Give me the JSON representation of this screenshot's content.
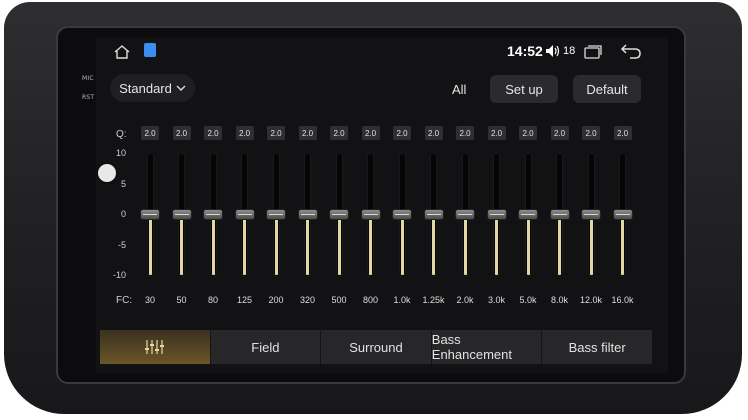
{
  "hardware": {
    "mic_label": "MIC",
    "rst_label": "RST"
  },
  "status_bar": {
    "time": "14:52",
    "volume": "18",
    "icons": [
      "home-icon",
      "app-icon",
      "volume-icon",
      "window-icon",
      "back-icon"
    ]
  },
  "toolbar": {
    "preset_label": "Standard",
    "all_label": "All",
    "setup_label": "Set up",
    "default_label": "Default"
  },
  "eq": {
    "q_label": "Q:",
    "fc_label": "FC:",
    "y_ticks": [
      "10",
      "5",
      "0",
      "-5",
      "-10"
    ],
    "bands": [
      {
        "fc": "30",
        "q": "2.0",
        "gain": 0
      },
      {
        "fc": "50",
        "q": "2.0",
        "gain": 0
      },
      {
        "fc": "80",
        "q": "2.0",
        "gain": 0
      },
      {
        "fc": "125",
        "q": "2.0",
        "gain": 0
      },
      {
        "fc": "200",
        "q": "2.0",
        "gain": 0
      },
      {
        "fc": "320",
        "q": "2.0",
        "gain": 0
      },
      {
        "fc": "500",
        "q": "2.0",
        "gain": 0
      },
      {
        "fc": "800",
        "q": "2.0",
        "gain": 0
      },
      {
        "fc": "1.0k",
        "q": "2.0",
        "gain": 0
      },
      {
        "fc": "1.25k",
        "q": "2.0",
        "gain": 0
      },
      {
        "fc": "2.0k",
        "q": "2.0",
        "gain": 0
      },
      {
        "fc": "3.0k",
        "q": "2.0",
        "gain": 0
      },
      {
        "fc": "5.0k",
        "q": "2.0",
        "gain": 0
      },
      {
        "fc": "8.0k",
        "q": "2.0",
        "gain": 0
      },
      {
        "fc": "12.0k",
        "q": "2.0",
        "gain": 0
      },
      {
        "fc": "16.0k",
        "q": "2.0",
        "gain": 0
      }
    ]
  },
  "tabs": [
    {
      "label": "",
      "icon": "equalizer-icon",
      "active": true
    },
    {
      "label": "Field",
      "active": false
    },
    {
      "label": "Surround",
      "active": false
    },
    {
      "label": "Bass Enhancement",
      "active": false
    },
    {
      "label": "Bass filter",
      "active": false
    }
  ],
  "colors": {
    "accent": "#e6d6a6",
    "active_tab": "#6b5628",
    "panel": "#27272a"
  }
}
